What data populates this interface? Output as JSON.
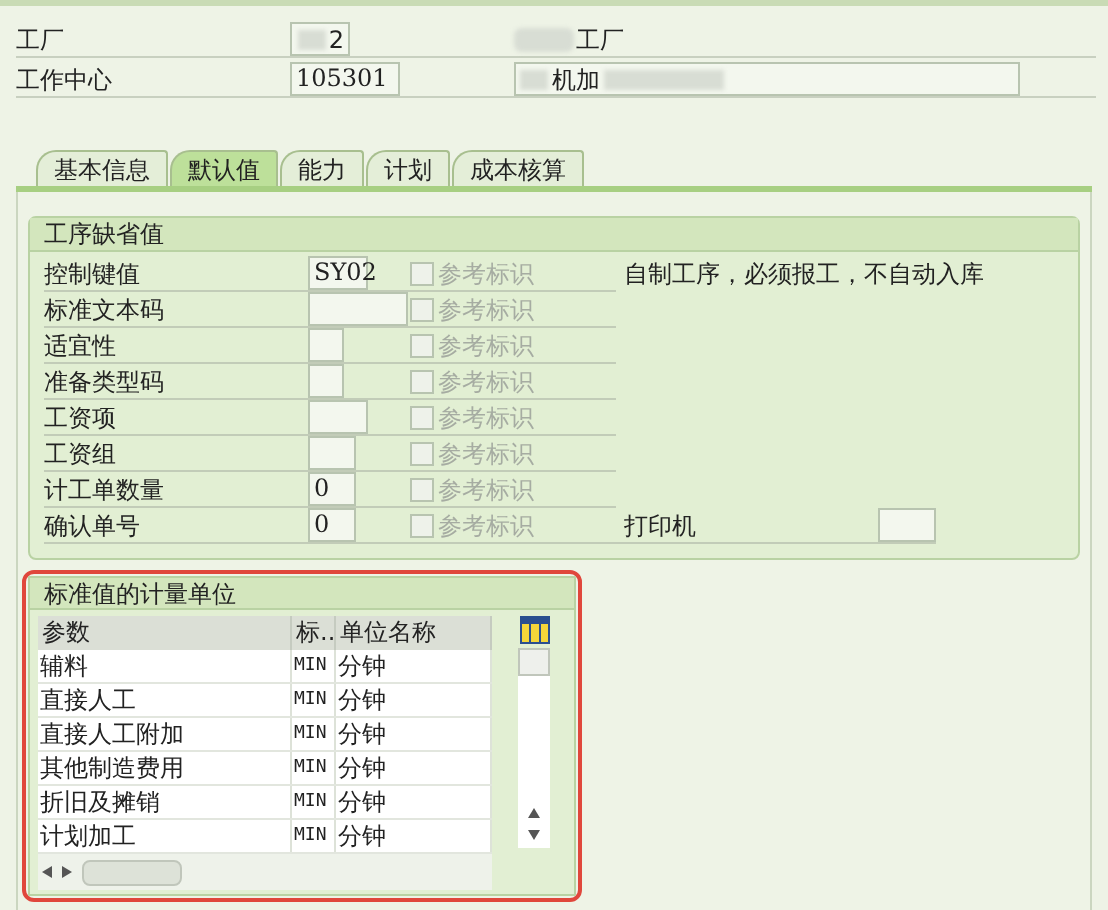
{
  "header": {
    "plant_label": "工厂",
    "plant_value": "2",
    "plant_name": "工厂",
    "work_center_label": "工作中心",
    "work_center_value": "105301",
    "work_center_name": "机加"
  },
  "tabs": [
    {
      "label": "基本信息",
      "selected": false
    },
    {
      "label": "默认值",
      "selected": true
    },
    {
      "label": "能力",
      "selected": false
    },
    {
      "label": "计划",
      "selected": false
    },
    {
      "label": "成本核算",
      "selected": false
    }
  ],
  "defaults": {
    "title": "工序缺省值",
    "fields": [
      {
        "label": "控制键值",
        "value": "SY02",
        "ref_label": "参考标识",
        "ref_checked": false,
        "note": "自制工序，必须报工，不自动入库"
      },
      {
        "label": "标准文本码",
        "ref_label": "参考标识",
        "ref_checked": false
      },
      {
        "label": "适宜性",
        "ref_label": "参考标识",
        "ref_checked": false
      },
      {
        "label": "准备类型码",
        "ref_label": "参考标识",
        "ref_checked": false
      },
      {
        "label": "工资项",
        "ref_label": "参考标识",
        "ref_checked": false
      },
      {
        "label": "工资组",
        "ref_label": "参考标识",
        "ref_checked": false
      },
      {
        "label": "计工单数量",
        "value": "0",
        "ref_label": "参考标识",
        "ref_checked": false
      },
      {
        "label": "确认单号",
        "value": "0",
        "ref_label": "参考标识",
        "ref_checked": false,
        "extra_label": "打印机"
      }
    ]
  },
  "units": {
    "title": "标准值的计量单位",
    "columns": [
      "参数",
      "标..",
      "单位名称"
    ],
    "rows": [
      [
        "辅料",
        "MIN",
        "分钟"
      ],
      [
        "直接人工",
        "MIN",
        "分钟"
      ],
      [
        "直接人工附加",
        "MIN",
        "分钟"
      ],
      [
        "其他制造费用",
        "MIN",
        "分钟"
      ],
      [
        "折旧及摊销",
        "MIN",
        "分钟"
      ],
      [
        "计划加工",
        "MIN",
        "分钟"
      ]
    ]
  }
}
